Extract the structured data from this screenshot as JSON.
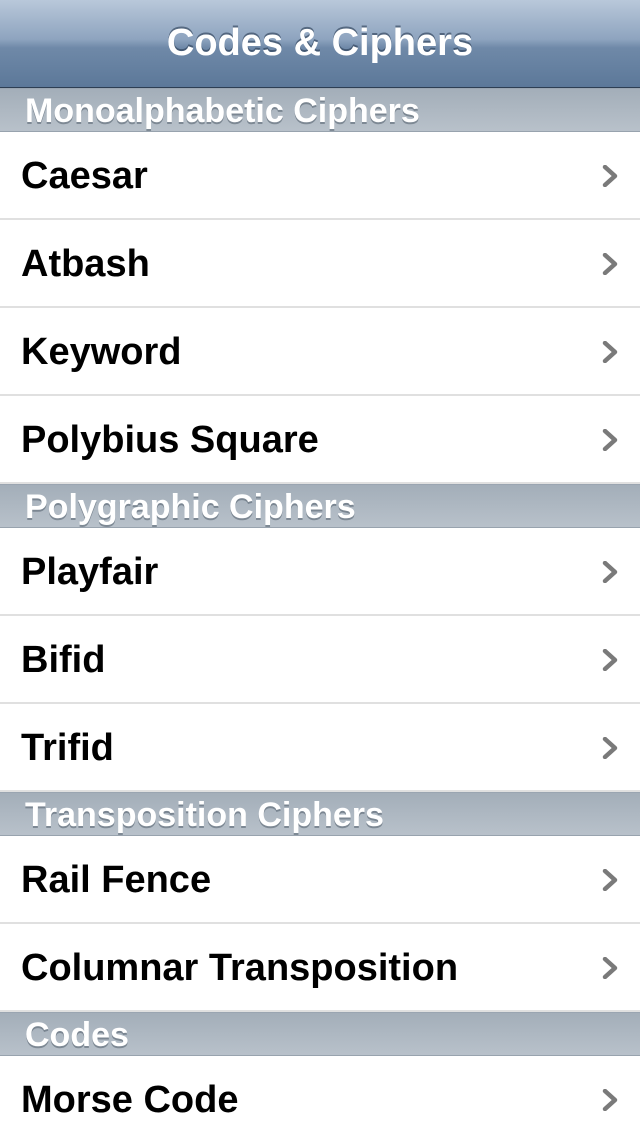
{
  "navbar": {
    "title": "Codes & Ciphers"
  },
  "sections": [
    {
      "header": "Monoalphabetic Ciphers",
      "items": [
        "Caesar",
        "Atbash",
        "Keyword",
        "Polybius Square"
      ]
    },
    {
      "header": "Polygraphic Ciphers",
      "items": [
        "Playfair",
        "Bifid",
        "Trifid"
      ]
    },
    {
      "header": "Transposition Ciphers",
      "items": [
        "Rail Fence",
        "Columnar Transposition"
      ]
    },
    {
      "header": "Codes",
      "items": [
        "Morse Code"
      ]
    }
  ],
  "icons": {
    "row_accessory": "chevron-right-icon"
  },
  "colors": {
    "navbar_top": "#b9c8da",
    "navbar_bottom": "#5c7899",
    "section_header": "#b0bac4",
    "chevron": "#7a7a7a"
  }
}
